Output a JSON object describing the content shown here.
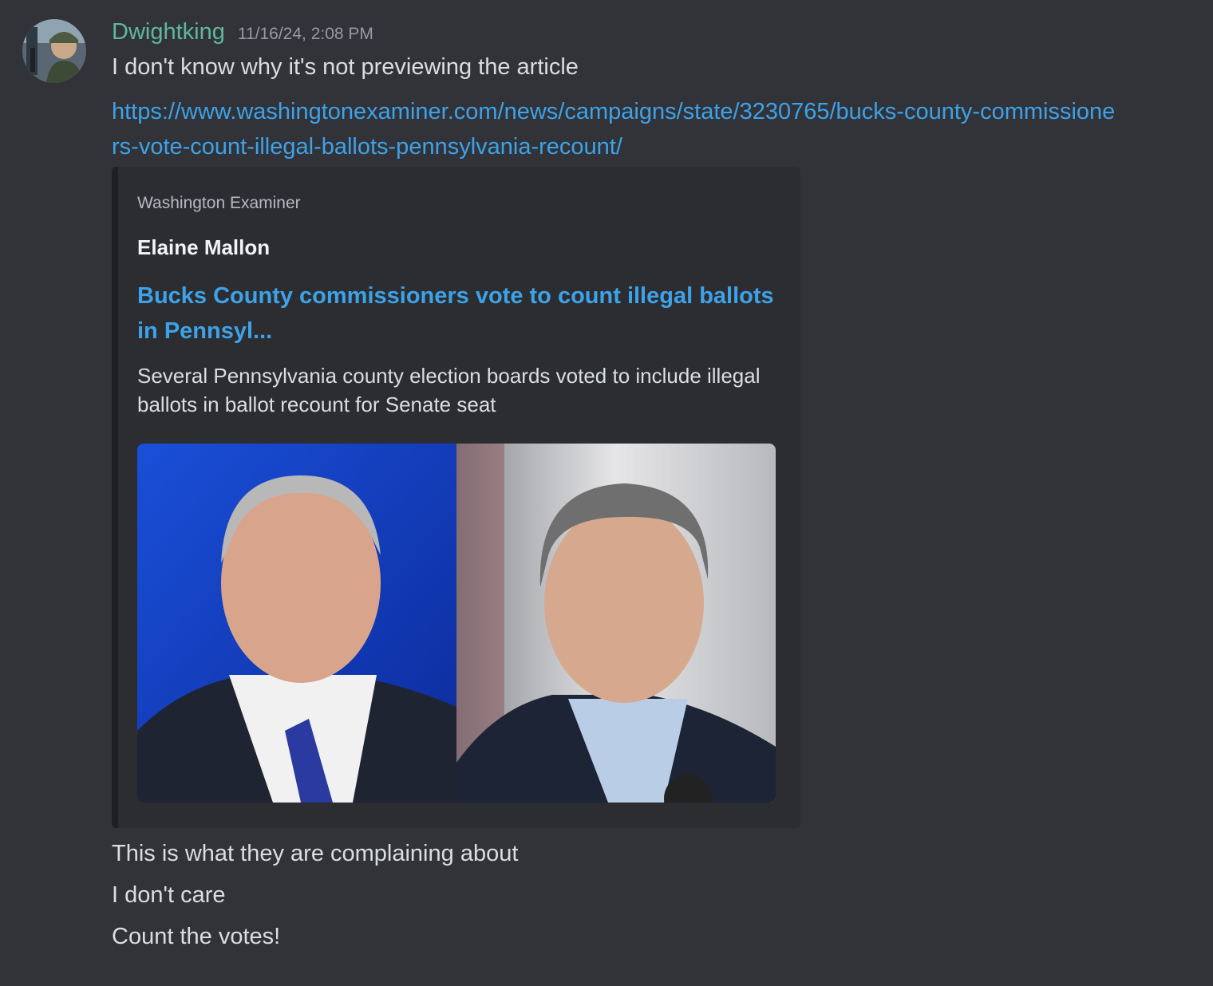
{
  "message": {
    "username": "Dwightking",
    "timestamp": "11/16/24, 2:08 PM",
    "lines_before": [
      "I don't know why it's not previewing the article"
    ],
    "link": "https://www.washingtonexaminer.com/news/campaigns/state/3230765/bucks-county-commissioners-vote-count-illegal-ballots-pennsylvania-recount/",
    "lines_after": [
      "This is what they are complaining about",
      "I don't care",
      "Count the votes!"
    ]
  },
  "embed": {
    "provider": "Washington Examiner",
    "author": "Elaine Mallon",
    "title": "Bucks County commissioners vote to count illegal ballots in Pennsyl...",
    "description": "Several Pennsylvania county election boards voted to include illegal ballots in ballot recount for Senate seat"
  },
  "colors": {
    "background": "#313338",
    "username": "#5fb89a",
    "link": "#3ea2e8",
    "embed_background": "#2b2d31"
  }
}
